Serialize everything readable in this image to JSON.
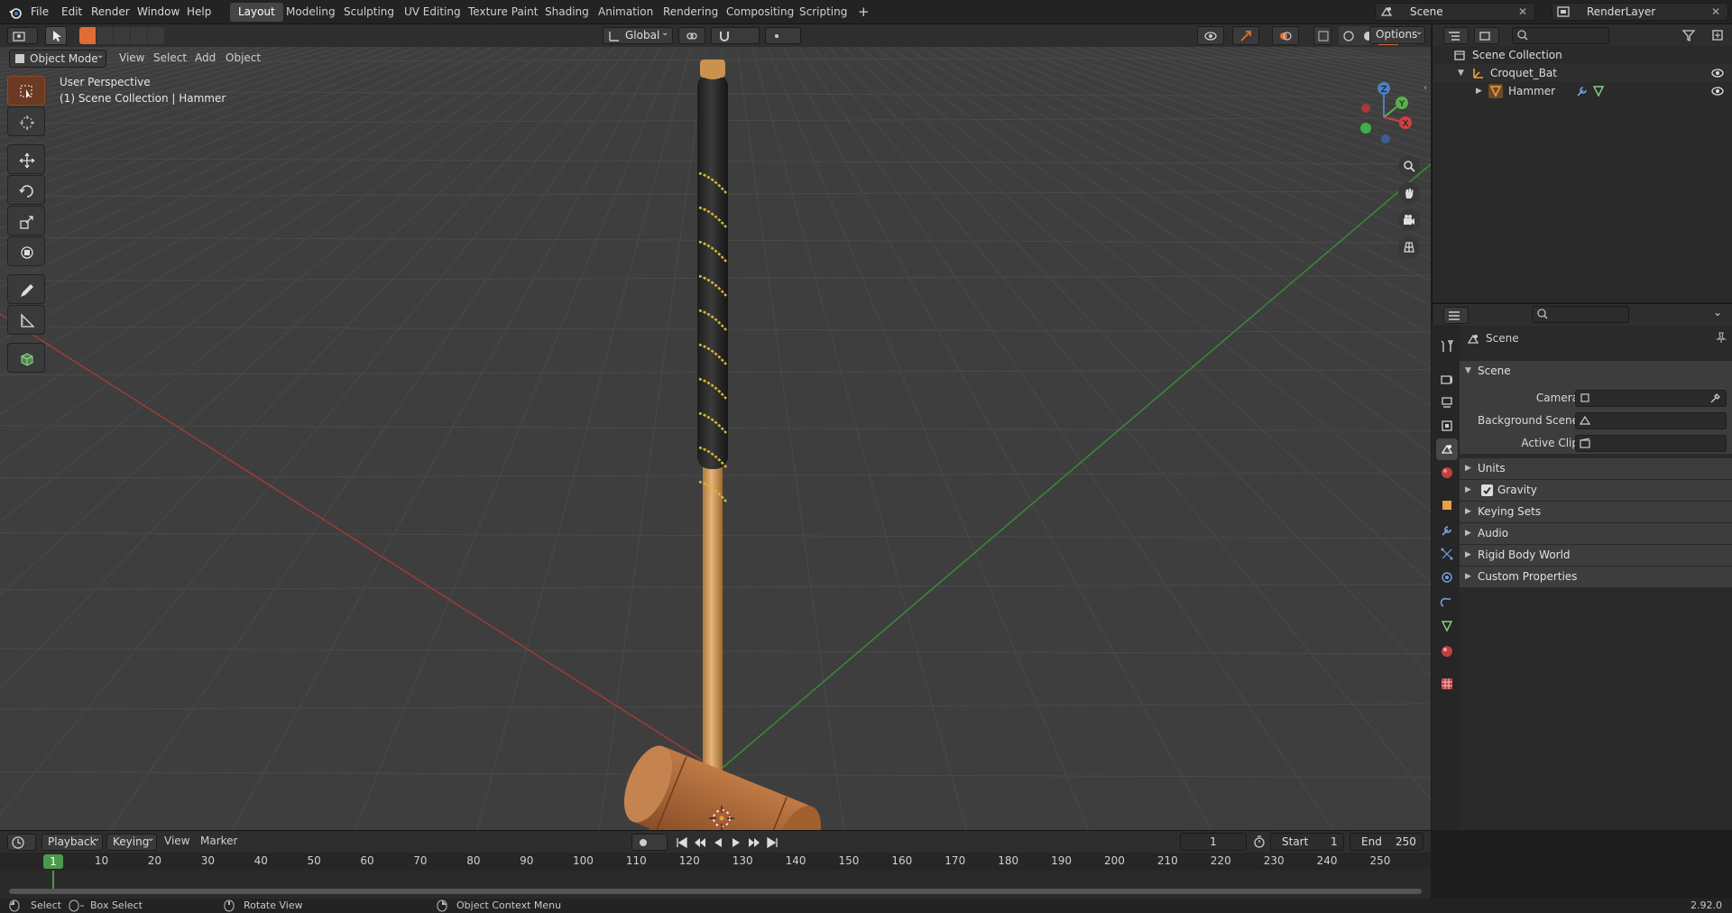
{
  "topbar": {
    "menus": [
      "File",
      "Edit",
      "Render",
      "Window",
      "Help"
    ],
    "workspaces": [
      "Layout",
      "Modeling",
      "Sculpting",
      "UV Editing",
      "Texture Paint",
      "Shading",
      "Animation",
      "Rendering",
      "Compositing",
      "Scripting"
    ],
    "active_workspace": "Layout",
    "add_tab": "+",
    "scene": "Scene",
    "view_layer": "RenderLayer"
  },
  "viewport_header": {
    "mode": "Object Mode",
    "menus": [
      "View",
      "Select",
      "Add",
      "Object"
    ],
    "orientation": "Global",
    "options": "Options"
  },
  "viewport": {
    "title": "User Perspective",
    "subtitle": "(1) Scene Collection | Hammer",
    "gizmo": {
      "x": "X",
      "y": "Y",
      "z": "Z"
    }
  },
  "outliner": {
    "root": "Scene Collection",
    "items": [
      {
        "name": "Croquet_Bat",
        "level": 1
      },
      {
        "name": "Hammer",
        "level": 2
      }
    ]
  },
  "properties": {
    "context": "Scene",
    "sections": {
      "scene": {
        "title": "Scene",
        "fields": {
          "camera": "Camera",
          "background_scene": "Background Scene",
          "active_clip": "Active Clip"
        }
      },
      "collapsed": [
        "Units",
        "Gravity",
        "Keying Sets",
        "Audio",
        "Rigid Body World",
        "Custom Properties"
      ]
    }
  },
  "timeline": {
    "menus": [
      "Playback",
      "Keying",
      "View",
      "Marker"
    ],
    "current_frame": "1",
    "start_label": "Start",
    "start": "1",
    "end_label": "End",
    "end": "250",
    "ticks": [
      "10",
      "20",
      "30",
      "40",
      "50",
      "60",
      "70",
      "80",
      "90",
      "100",
      "110",
      "120",
      "130",
      "140",
      "150",
      "160",
      "170",
      "180",
      "190",
      "200",
      "210",
      "220",
      "230",
      "240",
      "250"
    ],
    "playhead": "1"
  },
  "statusbar": {
    "select": "Select",
    "box_select": "Box Select",
    "rotate_view": "Rotate View",
    "context_menu": "Object Context Menu",
    "version": "2.92.0"
  },
  "colors": {
    "accent": "#e06d35",
    "grid": "#4a4a4a",
    "x_axis": "#a03a3a",
    "y_axis": "#3a8a3a"
  }
}
